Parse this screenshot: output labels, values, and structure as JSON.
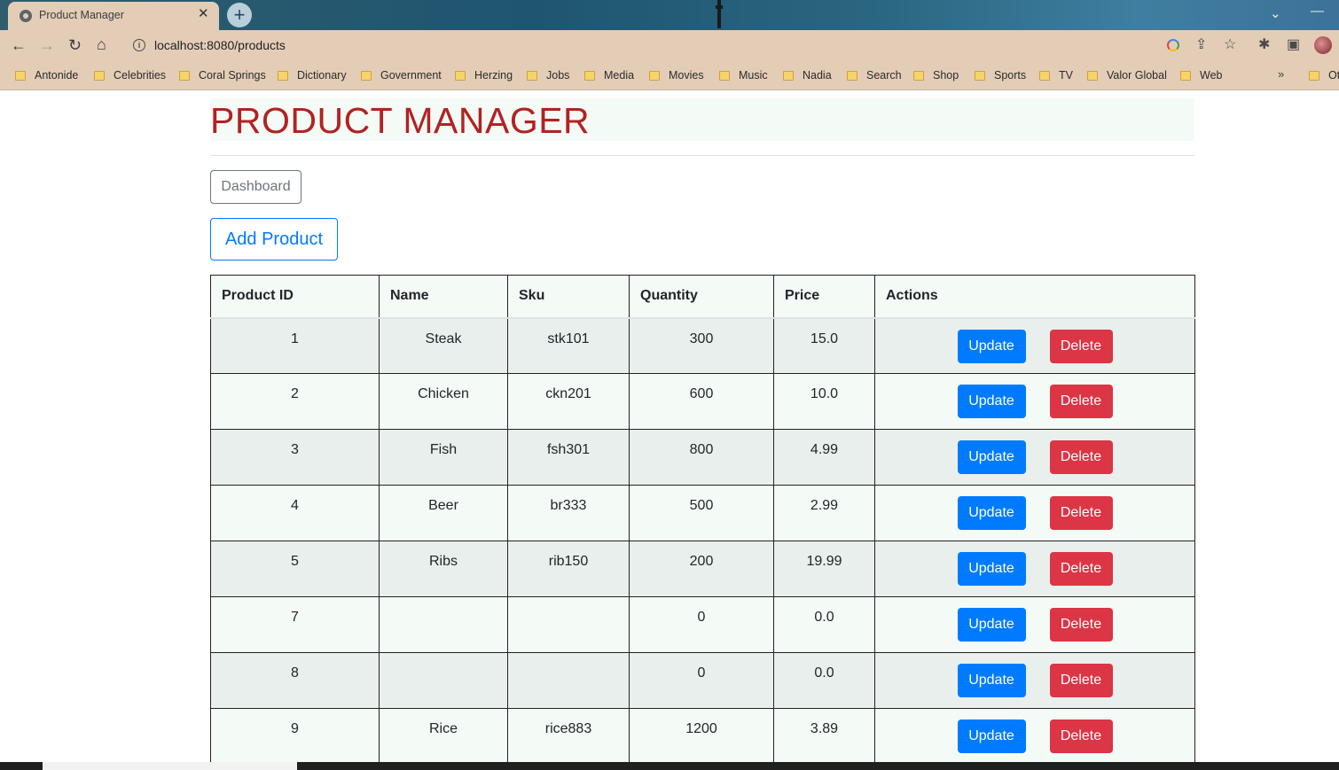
{
  "browser": {
    "tab_title": "Product Manager",
    "url": "localhost:8080/products",
    "bookmarks": [
      "Antonide",
      "Celebrities",
      "Coral Springs",
      "Dictionary",
      "Government",
      "Herzing",
      "Jobs",
      "Media",
      "Movies",
      "Music",
      "Nadia",
      "Search",
      "Shop",
      "Sports",
      "TV",
      "Valor Global",
      "Web",
      "Ot"
    ],
    "icons": [
      "back-icon",
      "forward-icon",
      "reload-icon",
      "home-icon",
      "info-icon",
      "google-icon",
      "share-icon",
      "star-icon",
      "extensions-icon",
      "side-panel-icon",
      "profile-avatar"
    ]
  },
  "page": {
    "title": "PRODUCT MANAGER",
    "dashboard_label": "Dashboard",
    "add_product_label": "Add Product"
  },
  "table": {
    "headers": [
      "Product ID",
      "Name",
      "Sku",
      "Quantity",
      "Price",
      "Actions"
    ],
    "update_label": "Update",
    "delete_label": "Delete",
    "rows": [
      {
        "id": "1",
        "name": "Steak",
        "sku": "stk101",
        "quantity": "300",
        "price": "15.0"
      },
      {
        "id": "2",
        "name": "Chicken",
        "sku": "ckn201",
        "quantity": "600",
        "price": "10.0"
      },
      {
        "id": "3",
        "name": "Fish",
        "sku": "fsh301",
        "quantity": "800",
        "price": "4.99"
      },
      {
        "id": "4",
        "name": "Beer",
        "sku": "br333",
        "quantity": "500",
        "price": "2.99"
      },
      {
        "id": "5",
        "name": "Ribs",
        "sku": "rib150",
        "quantity": "200",
        "price": "19.99"
      },
      {
        "id": "7",
        "name": "",
        "sku": "",
        "quantity": "0",
        "price": "0.0"
      },
      {
        "id": "8",
        "name": "",
        "sku": "",
        "quantity": "0",
        "price": "0.0"
      },
      {
        "id": "9",
        "name": "Rice",
        "sku": "rice883",
        "quantity": "1200",
        "price": "3.89"
      }
    ]
  },
  "colors": {
    "title_red": "#b22222",
    "primary_blue": "#007bff",
    "danger_red": "#dc3545",
    "chrome_beige": "#e4cdb7"
  }
}
